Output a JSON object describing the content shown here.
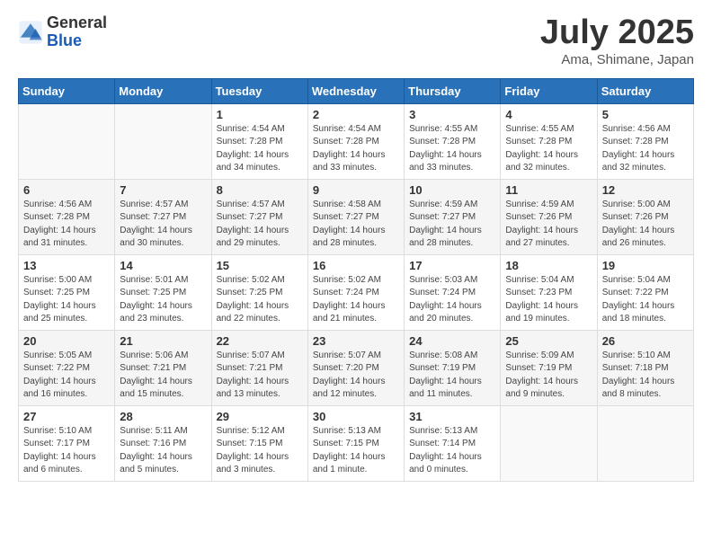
{
  "logo": {
    "general": "General",
    "blue": "Blue"
  },
  "title": "July 2025",
  "location": "Ama, Shimane, Japan",
  "weekdays": [
    "Sunday",
    "Monday",
    "Tuesday",
    "Wednesday",
    "Thursday",
    "Friday",
    "Saturday"
  ],
  "weeks": [
    [
      {
        "num": "",
        "info": ""
      },
      {
        "num": "",
        "info": ""
      },
      {
        "num": "1",
        "info": "Sunrise: 4:54 AM\nSunset: 7:28 PM\nDaylight: 14 hours and 34 minutes."
      },
      {
        "num": "2",
        "info": "Sunrise: 4:54 AM\nSunset: 7:28 PM\nDaylight: 14 hours and 33 minutes."
      },
      {
        "num": "3",
        "info": "Sunrise: 4:55 AM\nSunset: 7:28 PM\nDaylight: 14 hours and 33 minutes."
      },
      {
        "num": "4",
        "info": "Sunrise: 4:55 AM\nSunset: 7:28 PM\nDaylight: 14 hours and 32 minutes."
      },
      {
        "num": "5",
        "info": "Sunrise: 4:56 AM\nSunset: 7:28 PM\nDaylight: 14 hours and 32 minutes."
      }
    ],
    [
      {
        "num": "6",
        "info": "Sunrise: 4:56 AM\nSunset: 7:28 PM\nDaylight: 14 hours and 31 minutes."
      },
      {
        "num": "7",
        "info": "Sunrise: 4:57 AM\nSunset: 7:27 PM\nDaylight: 14 hours and 30 minutes."
      },
      {
        "num": "8",
        "info": "Sunrise: 4:57 AM\nSunset: 7:27 PM\nDaylight: 14 hours and 29 minutes."
      },
      {
        "num": "9",
        "info": "Sunrise: 4:58 AM\nSunset: 7:27 PM\nDaylight: 14 hours and 28 minutes."
      },
      {
        "num": "10",
        "info": "Sunrise: 4:59 AM\nSunset: 7:27 PM\nDaylight: 14 hours and 28 minutes."
      },
      {
        "num": "11",
        "info": "Sunrise: 4:59 AM\nSunset: 7:26 PM\nDaylight: 14 hours and 27 minutes."
      },
      {
        "num": "12",
        "info": "Sunrise: 5:00 AM\nSunset: 7:26 PM\nDaylight: 14 hours and 26 minutes."
      }
    ],
    [
      {
        "num": "13",
        "info": "Sunrise: 5:00 AM\nSunset: 7:25 PM\nDaylight: 14 hours and 25 minutes."
      },
      {
        "num": "14",
        "info": "Sunrise: 5:01 AM\nSunset: 7:25 PM\nDaylight: 14 hours and 23 minutes."
      },
      {
        "num": "15",
        "info": "Sunrise: 5:02 AM\nSunset: 7:25 PM\nDaylight: 14 hours and 22 minutes."
      },
      {
        "num": "16",
        "info": "Sunrise: 5:02 AM\nSunset: 7:24 PM\nDaylight: 14 hours and 21 minutes."
      },
      {
        "num": "17",
        "info": "Sunrise: 5:03 AM\nSunset: 7:24 PM\nDaylight: 14 hours and 20 minutes."
      },
      {
        "num": "18",
        "info": "Sunrise: 5:04 AM\nSunset: 7:23 PM\nDaylight: 14 hours and 19 minutes."
      },
      {
        "num": "19",
        "info": "Sunrise: 5:04 AM\nSunset: 7:22 PM\nDaylight: 14 hours and 18 minutes."
      }
    ],
    [
      {
        "num": "20",
        "info": "Sunrise: 5:05 AM\nSunset: 7:22 PM\nDaylight: 14 hours and 16 minutes."
      },
      {
        "num": "21",
        "info": "Sunrise: 5:06 AM\nSunset: 7:21 PM\nDaylight: 14 hours and 15 minutes."
      },
      {
        "num": "22",
        "info": "Sunrise: 5:07 AM\nSunset: 7:21 PM\nDaylight: 14 hours and 13 minutes."
      },
      {
        "num": "23",
        "info": "Sunrise: 5:07 AM\nSunset: 7:20 PM\nDaylight: 14 hours and 12 minutes."
      },
      {
        "num": "24",
        "info": "Sunrise: 5:08 AM\nSunset: 7:19 PM\nDaylight: 14 hours and 11 minutes."
      },
      {
        "num": "25",
        "info": "Sunrise: 5:09 AM\nSunset: 7:19 PM\nDaylight: 14 hours and 9 minutes."
      },
      {
        "num": "26",
        "info": "Sunrise: 5:10 AM\nSunset: 7:18 PM\nDaylight: 14 hours and 8 minutes."
      }
    ],
    [
      {
        "num": "27",
        "info": "Sunrise: 5:10 AM\nSunset: 7:17 PM\nDaylight: 14 hours and 6 minutes."
      },
      {
        "num": "28",
        "info": "Sunrise: 5:11 AM\nSunset: 7:16 PM\nDaylight: 14 hours and 5 minutes."
      },
      {
        "num": "29",
        "info": "Sunrise: 5:12 AM\nSunset: 7:15 PM\nDaylight: 14 hours and 3 minutes."
      },
      {
        "num": "30",
        "info": "Sunrise: 5:13 AM\nSunset: 7:15 PM\nDaylight: 14 hours and 1 minute."
      },
      {
        "num": "31",
        "info": "Sunrise: 5:13 AM\nSunset: 7:14 PM\nDaylight: 14 hours and 0 minutes."
      },
      {
        "num": "",
        "info": ""
      },
      {
        "num": "",
        "info": ""
      }
    ]
  ]
}
